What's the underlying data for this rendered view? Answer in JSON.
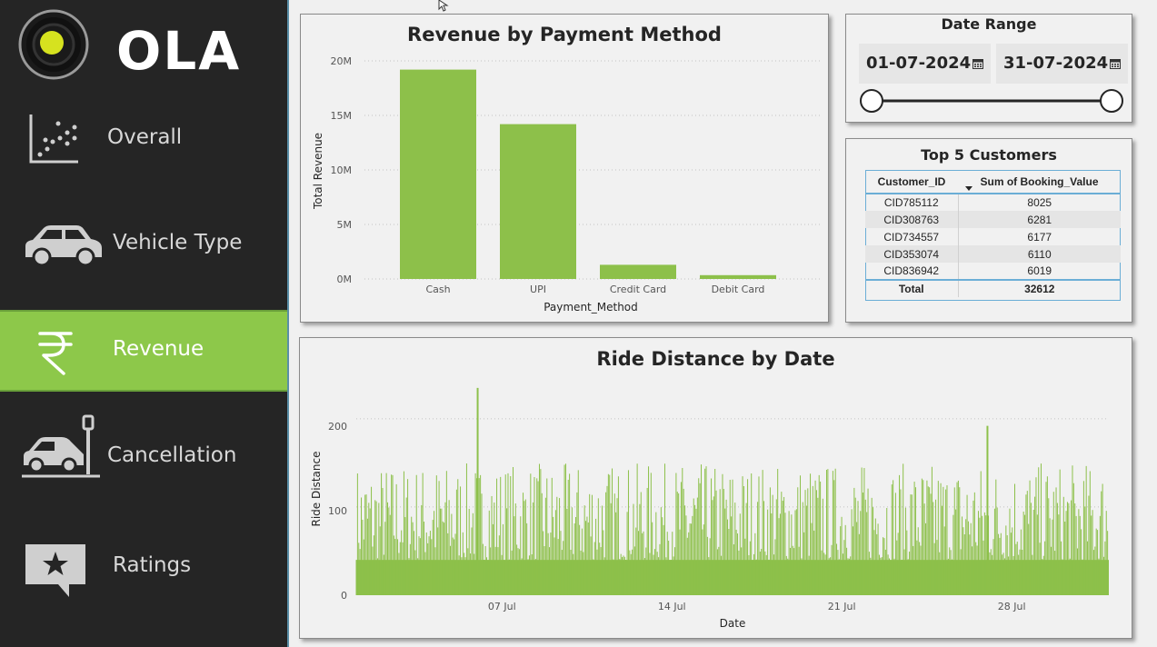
{
  "brand": {
    "name": "OLA"
  },
  "sidebar": {
    "items": [
      {
        "label": "Overall",
        "icon": "scatter-chart-icon",
        "active": false
      },
      {
        "label": "Vehicle Type",
        "icon": "car-icon",
        "active": false
      },
      {
        "label": "Revenue",
        "icon": "rupee-icon",
        "active": true
      },
      {
        "label": "Cancellation",
        "icon": "car-crash-icon",
        "active": false
      },
      {
        "label": "Ratings",
        "icon": "star-message-icon",
        "active": false
      }
    ],
    "active_color": "#8dc84a",
    "background": "#252525"
  },
  "revenue_chart": {
    "title": "Revenue by Payment Method",
    "xlabel": "Payment_Method",
    "ylabel": "Total Revenue",
    "yticks": [
      "20M",
      "15M",
      "10M",
      "5M",
      "0M"
    ]
  },
  "date_range": {
    "title": "Date Range",
    "start": "01-07-2024",
    "end": "31-07-2024"
  },
  "top_customers": {
    "title": "Top 5 Customers",
    "columns": [
      "Customer_ID",
      "Sum of Booking_Value"
    ],
    "rows": [
      [
        "CID785112",
        "8025"
      ],
      [
        "CID308763",
        "6281"
      ],
      [
        "CID734557",
        "6177"
      ],
      [
        "CID353074",
        "6110"
      ],
      [
        "CID836942",
        "6019"
      ]
    ],
    "total_label": "Total",
    "total_value": "32612"
  },
  "distance_chart": {
    "title": "Ride Distance by Date",
    "xlabel": "Date",
    "ylabel": "Ride Distance",
    "yticks": [
      "200",
      "100",
      "0"
    ],
    "xticks": [
      "07 Jul",
      "14 Jul",
      "21 Jul",
      "28 Jul"
    ]
  },
  "chart_data": [
    {
      "type": "bar",
      "title": "Revenue by Payment Method",
      "xlabel": "Payment_Method",
      "ylabel": "Total Revenue",
      "categories": [
        "Cash",
        "UPI",
        "Credit Card",
        "Debit Card"
      ],
      "values": [
        19200000,
        14200000,
        1300000,
        350000
      ],
      "ylim": [
        0,
        20000000
      ],
      "color": "#8dc04a",
      "grid": true
    },
    {
      "type": "bar",
      "title": "Ride Distance by Date",
      "xlabel": "Date",
      "ylabel": "Ride Distance",
      "x_start": "2024-07-01",
      "x_end": "2024-07-31",
      "xticks": [
        "07 Jul",
        "14 Jul",
        "21 Jul",
        "28 Jul"
      ],
      "ylim": [
        0,
        240
      ],
      "peaks": [
        {
          "date": "2024-07-06",
          "value": 235
        },
        {
          "date": "2024-07-27",
          "value": 192
        }
      ],
      "typical_max": 150,
      "color": "#8dc04a",
      "grid": true
    }
  ]
}
